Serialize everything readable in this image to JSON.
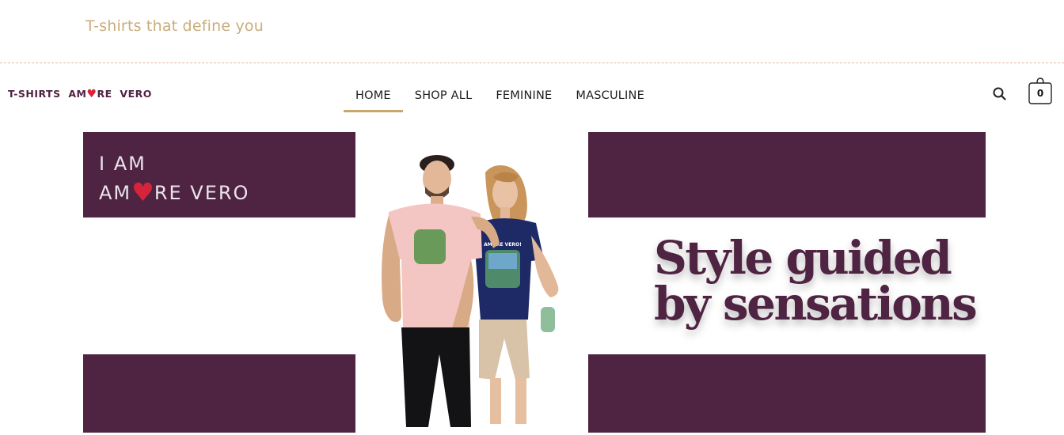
{
  "header": {
    "tagline": "T-shirts that define you"
  },
  "logo": {
    "part1": "T-SHIRTS",
    "part2": "AM",
    "heart": "♥",
    "part3": "RE",
    "part4": "VERO"
  },
  "nav": {
    "items": [
      {
        "label": "HOME",
        "active": true
      },
      {
        "label": "SHOP ALL"
      },
      {
        "label": "FEMININE"
      },
      {
        "label": "MASCULINE"
      }
    ]
  },
  "cart": {
    "count": "0"
  },
  "icons": {
    "search": "search-icon",
    "cart": "shopping-bag-icon",
    "heart": "heart-icon"
  },
  "hero": {
    "brand_line1": "I AM",
    "brand_line2_a": "AM",
    "brand_line2_heart": "♥",
    "brand_line2_b": "RE VERO",
    "slogan_line1": "Style guided",
    "slogan_line2": "by sensations",
    "tshirt_woman_print": "AMORE VERO!"
  },
  "colors": {
    "plum": "#4f2342",
    "gold": "#c9a66b",
    "tagline": "#c9ad7b",
    "heart_red": "#d6243a"
  }
}
